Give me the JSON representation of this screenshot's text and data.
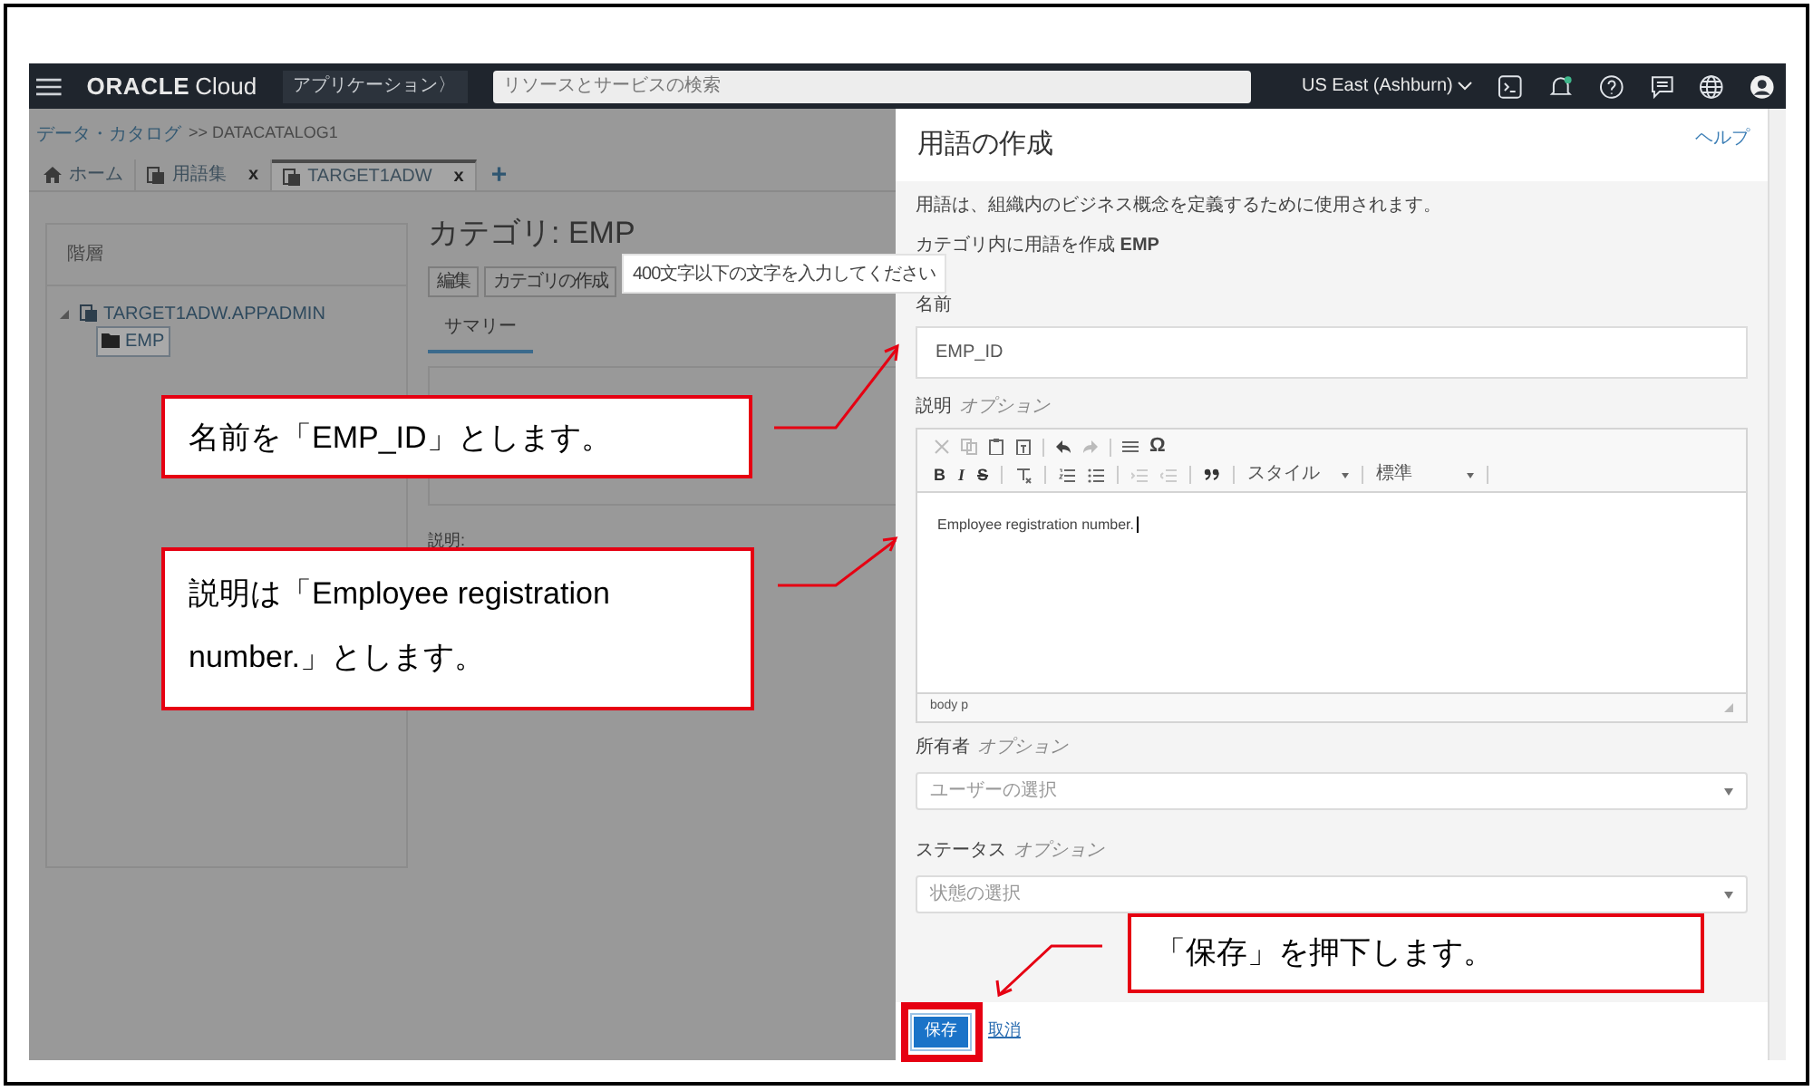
{
  "header": {
    "brand": "ORACLE",
    "product": "Cloud",
    "apps_button": "アプリケーション〉",
    "search_placeholder": "リソースとサービスの検索",
    "region": "US East (Ashburn)"
  },
  "breadcrumb": {
    "link": "データ・カタログ",
    "current": ">> DATACATALOG1"
  },
  "tabs": [
    {
      "kind": "home",
      "label": "ホーム",
      "selected": false
    },
    {
      "kind": "glossary",
      "label": "用語集",
      "close": "x",
      "selected": false
    },
    {
      "kind": "glossary",
      "label": "TARGET1ADW",
      "close": "x",
      "selected": true
    }
  ],
  "add_tab": "+",
  "hierarchy": {
    "title": "階層",
    "tree": [
      {
        "label": "TARGET1ADW.APPADMIN",
        "expanded": true,
        "selected": false,
        "children": [
          {
            "label": "EMP",
            "selected": true
          }
        ]
      }
    ]
  },
  "category": {
    "title": "カテゴリ: EMP",
    "buttons": [
      "編集",
      "カテゴリの作成"
    ],
    "tabs": [
      {
        "label": "サマリー",
        "selected": true
      }
    ],
    "description_label": "説明:"
  },
  "tooltip": "400文字以下の文字を入力してください",
  "panel": {
    "title": "用語の作成",
    "help": "ヘルプ",
    "intro": "用語は、組織内のビジネス概念を定義するために使用されます。",
    "context": "カテゴリ内に用語を作成 **EMP**",
    "fields": [
      {
        "kind": "text",
        "label": "名前",
        "value": "EMP_ID"
      },
      {
        "kind": "rich",
        "label": "説明",
        "optional": "オプション",
        "value": "Employee registration number.",
        "format_buttons": [
          "B",
          "I",
          "S"
        ],
        "special_char": "Ω",
        "style_menu": "スタイル",
        "format_menu": "標準",
        "path": "body p"
      },
      {
        "kind": "select",
        "label": "所有者",
        "optional": "オプション",
        "placeholder": "ユーザーの選択"
      },
      {
        "kind": "select",
        "label": "ステータス",
        "optional": "オプション",
        "placeholder": "状態の選択"
      }
    ],
    "save": "保存",
    "cancel": "取消"
  },
  "callouts": [
    {
      "text": "名前を「EMP_ID」とします。"
    },
    {
      "text": "説明は「Employee registration number.」とします。"
    },
    {
      "text": "「保存」を押下します。"
    }
  ]
}
